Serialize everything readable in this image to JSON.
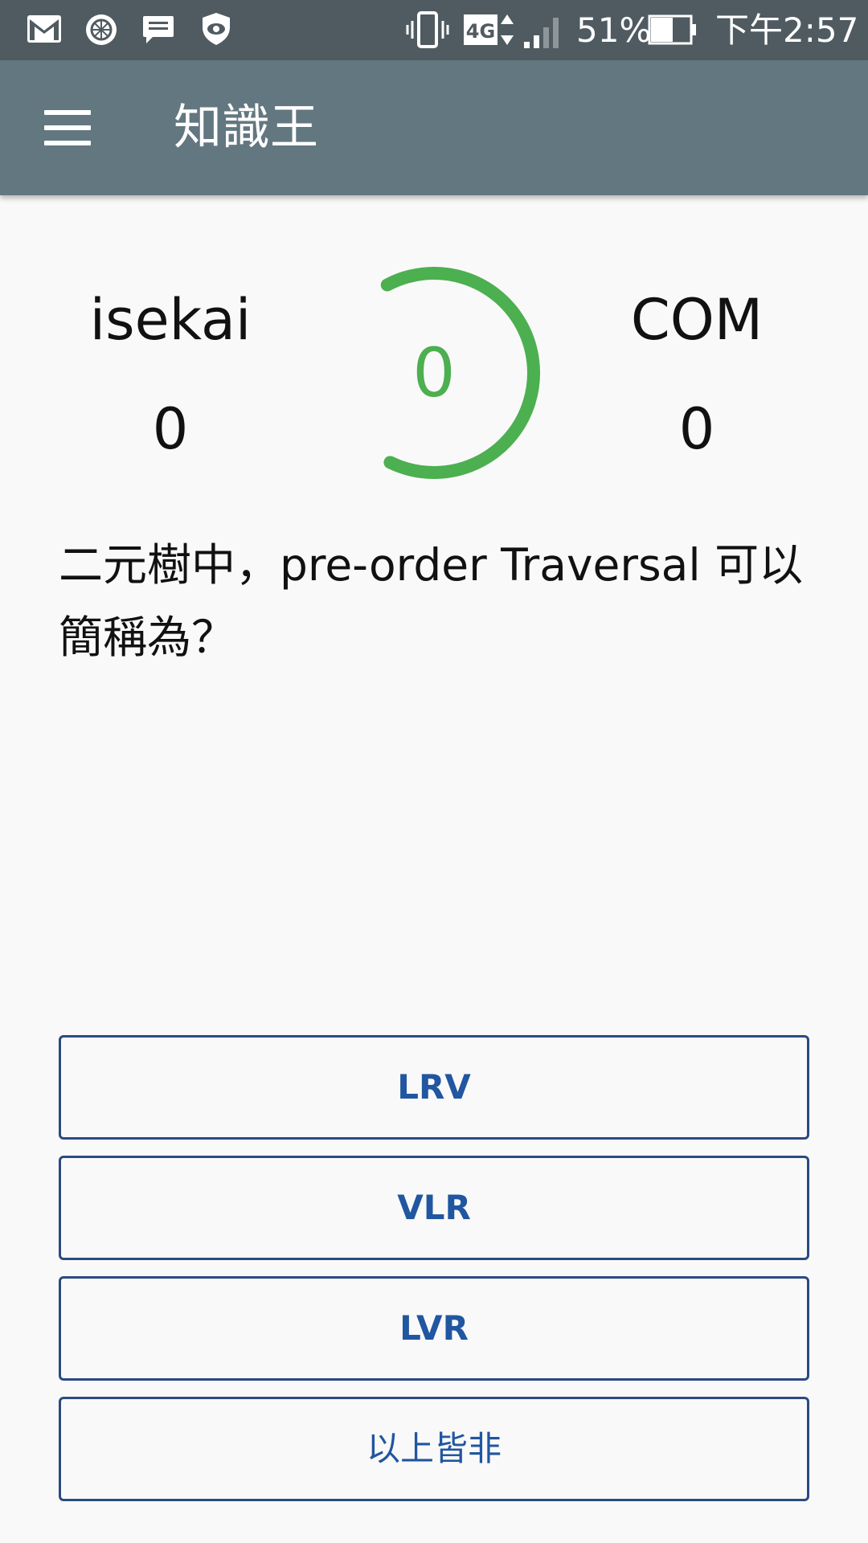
{
  "status_bar": {
    "battery_percent": "51%",
    "time": "下午2:57",
    "network": "4G",
    "icons": [
      "gmail-icon",
      "lemon-app-icon",
      "messages-icon",
      "shield-eye-icon",
      "vibrate-icon",
      "network-4g-icon",
      "signal-icon",
      "battery-icon"
    ]
  },
  "app_bar": {
    "title": "知識王",
    "menu_icon": "hamburger-menu-icon"
  },
  "players": {
    "left": {
      "name": "isekai",
      "score": "0"
    },
    "right": {
      "name": "COM",
      "score": "0"
    }
  },
  "timer": {
    "value": "0",
    "progress_fraction": 0.65,
    "color": "#4caf50"
  },
  "question": {
    "text": "二元樹中，pre-order Traversal 可以簡稱為？"
  },
  "options": [
    {
      "label": "LRV"
    },
    {
      "label": "VLR"
    },
    {
      "label": "LVR"
    },
    {
      "label": "以上皆非"
    }
  ],
  "colors": {
    "status_bar": "#505b61",
    "app_bar": "#637780",
    "accent": "#4caf50",
    "option_border": "#2b4a80",
    "option_text": "#2156a0"
  }
}
